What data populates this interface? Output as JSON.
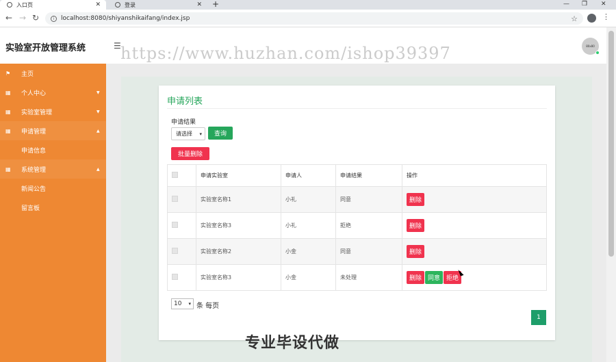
{
  "browser": {
    "tabs": [
      {
        "title": "入口页",
        "active": true
      },
      {
        "title": "登录",
        "active": false
      }
    ],
    "url": "localhost:8080/shiyanshikaifang/index.jsp"
  },
  "header": {
    "title": "实验室开放管理系统",
    "watermark": "https://www.huzhan.com/ishop39397",
    "avatar_text": "80x80"
  },
  "sidebar": {
    "items": [
      {
        "label": "主页",
        "icon": "flag-icon"
      },
      {
        "label": "个人中心",
        "icon": "grid-icon"
      },
      {
        "label": "实验室管理",
        "icon": "grid-icon"
      },
      {
        "label": "申请管理",
        "icon": "grid-icon"
      },
      {
        "label": "申请信息"
      },
      {
        "label": "系统管理",
        "icon": "grid-icon"
      },
      {
        "label": "新闻公告"
      },
      {
        "label": "留言板"
      }
    ]
  },
  "card": {
    "title": "申请列表",
    "filter_label": "申请结果",
    "select_value": "请选择",
    "query_button": "查询",
    "batch_delete_button": "批量删除",
    "columns": [
      "申请实验室",
      "申请人",
      "申请结果",
      "操作"
    ],
    "rows": [
      {
        "lab": "实验室名称1",
        "applicant": "小礼",
        "result": "同意",
        "actions": [
          "删除"
        ]
      },
      {
        "lab": "实验室名称3",
        "applicant": "小礼",
        "result": "拒绝",
        "actions": [
          "删除"
        ]
      },
      {
        "lab": "实验室名称2",
        "applicant": "小金",
        "result": "同意",
        "actions": [
          "删除"
        ]
      },
      {
        "lab": "实验室名称3",
        "applicant": "小金",
        "result": "未处理",
        "actions": [
          "删除",
          "同意",
          "拒绝"
        ]
      }
    ],
    "page_size": "10",
    "page_size_label": "条 每页",
    "current_page": "1"
  },
  "overlay": {
    "bottom_text": "专业毕设代做"
  },
  "colors": {
    "sidebar": "#ee8833",
    "accent_green": "#26a65b",
    "danger_red": "#f0334e"
  }
}
